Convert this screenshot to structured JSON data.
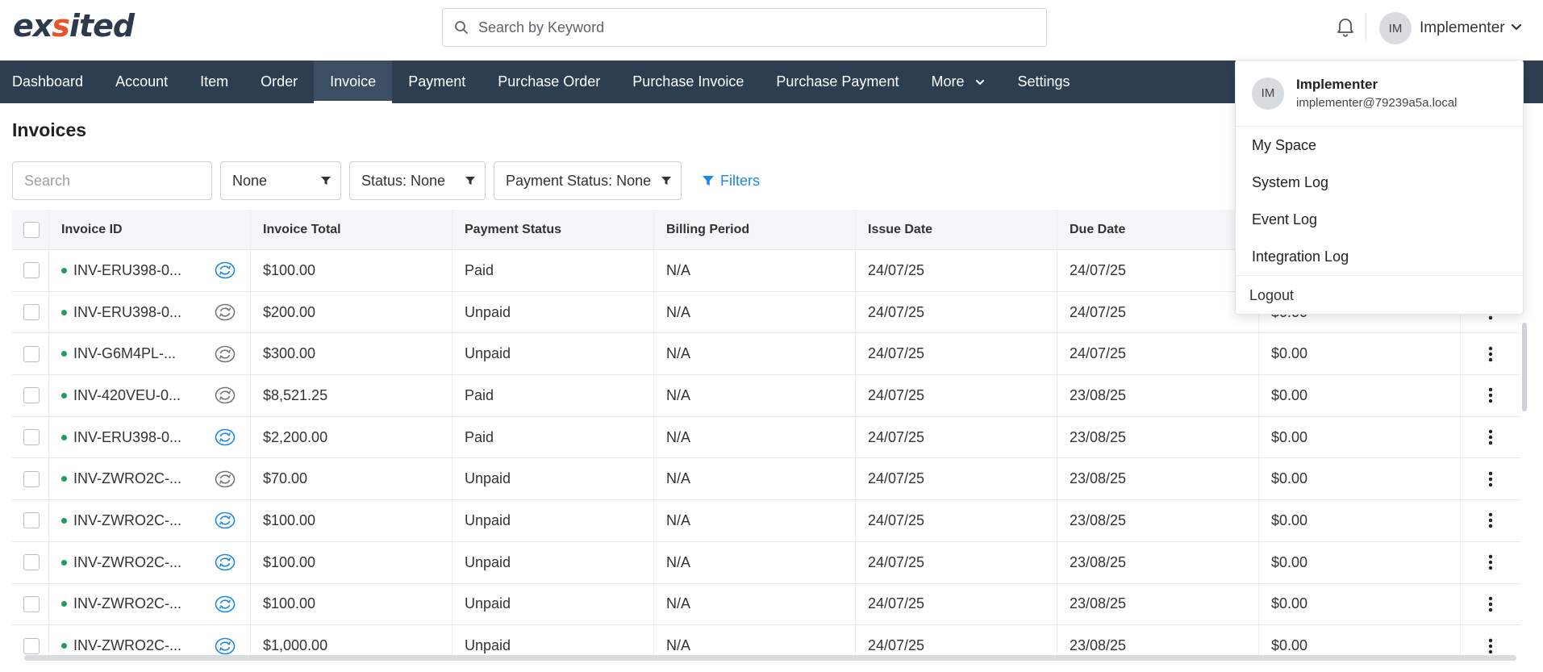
{
  "app": {
    "logo_prefix": "ex",
    "logo_accent": "s",
    "logo_suffix": "ited",
    "search_placeholder": "Search by Keyword",
    "user_initials": "IM",
    "user_name": "Implementer"
  },
  "nav": {
    "items": [
      {
        "label": "Dashboard"
      },
      {
        "label": "Account"
      },
      {
        "label": "Item"
      },
      {
        "label": "Order"
      },
      {
        "label": "Invoice",
        "active": true
      },
      {
        "label": "Payment"
      },
      {
        "label": "Purchase Order"
      },
      {
        "label": "Purchase Invoice"
      },
      {
        "label": "Purchase Payment"
      },
      {
        "label": "More"
      },
      {
        "label": "Settings"
      }
    ]
  },
  "page": {
    "title": "Invoices",
    "search_placeholder": "Search",
    "filter_none": "None",
    "filter_status": "Status: None",
    "filter_payment_status": "Payment Status: None",
    "filters_label": "Filters"
  },
  "table": {
    "headers": {
      "invoice_id": "Invoice ID",
      "invoice_total": "Invoice Total",
      "payment_status": "Payment Status",
      "billing_period": "Billing Period",
      "issue_date": "Issue Date",
      "due_date": "Due Date"
    },
    "rows": [
      {
        "id": "INV-ERU398-0...",
        "total": "$100.00",
        "status": "Paid",
        "billing": "N/A",
        "issue": "24/07/25",
        "due": "24/07/25",
        "balance": "",
        "sync": "active"
      },
      {
        "id": "INV-ERU398-0...",
        "total": "$200.00",
        "status": "Unpaid",
        "billing": "N/A",
        "issue": "24/07/25",
        "due": "24/07/25",
        "balance": "$0.00",
        "sync": "inactive"
      },
      {
        "id": "INV-G6M4PL-...",
        "total": "$300.00",
        "status": "Unpaid",
        "billing": "N/A",
        "issue": "24/07/25",
        "due": "24/07/25",
        "balance": "$0.00",
        "sync": "inactive"
      },
      {
        "id": "INV-420VEU-0...",
        "total": "$8,521.25",
        "status": "Paid",
        "billing": "N/A",
        "issue": "24/07/25",
        "due": "23/08/25",
        "balance": "$0.00",
        "sync": "inactive"
      },
      {
        "id": "INV-ERU398-0...",
        "total": "$2,200.00",
        "status": "Paid",
        "billing": "N/A",
        "issue": "24/07/25",
        "due": "23/08/25",
        "balance": "$0.00",
        "sync": "active"
      },
      {
        "id": "INV-ZWRO2C-...",
        "total": "$70.00",
        "status": "Unpaid",
        "billing": "N/A",
        "issue": "24/07/25",
        "due": "23/08/25",
        "balance": "$0.00",
        "sync": "inactive"
      },
      {
        "id": "INV-ZWRO2C-...",
        "total": "$100.00",
        "status": "Unpaid",
        "billing": "N/A",
        "issue": "24/07/25",
        "due": "23/08/25",
        "balance": "$0.00",
        "sync": "active"
      },
      {
        "id": "INV-ZWRO2C-...",
        "total": "$100.00",
        "status": "Unpaid",
        "billing": "N/A",
        "issue": "24/07/25",
        "due": "23/08/25",
        "balance": "$0.00",
        "sync": "active"
      },
      {
        "id": "INV-ZWRO2C-...",
        "total": "$100.00",
        "status": "Unpaid",
        "billing": "N/A",
        "issue": "24/07/25",
        "due": "23/08/25",
        "balance": "$0.00",
        "sync": "active"
      },
      {
        "id": "INV-ZWRO2C-...",
        "total": "$1,000.00",
        "status": "Unpaid",
        "billing": "N/A",
        "issue": "24/07/25",
        "due": "23/08/25",
        "balance": "$0.00",
        "sync": "active"
      }
    ]
  },
  "user_menu": {
    "initials": "IM",
    "name": "Implementer",
    "email": "implementer@79239a5a.local",
    "items": [
      {
        "label": "My Space"
      },
      {
        "label": "System Log"
      },
      {
        "label": "Event Log"
      },
      {
        "label": "Integration Log"
      }
    ],
    "logout": "Logout"
  },
  "colors": {
    "nav_bg": "#2c3e50",
    "accent_blue": "#1e88e5",
    "logo_dark": "#2b3a4c",
    "logo_orange": "#e8542a",
    "status_dot": "#1e9e5a"
  }
}
